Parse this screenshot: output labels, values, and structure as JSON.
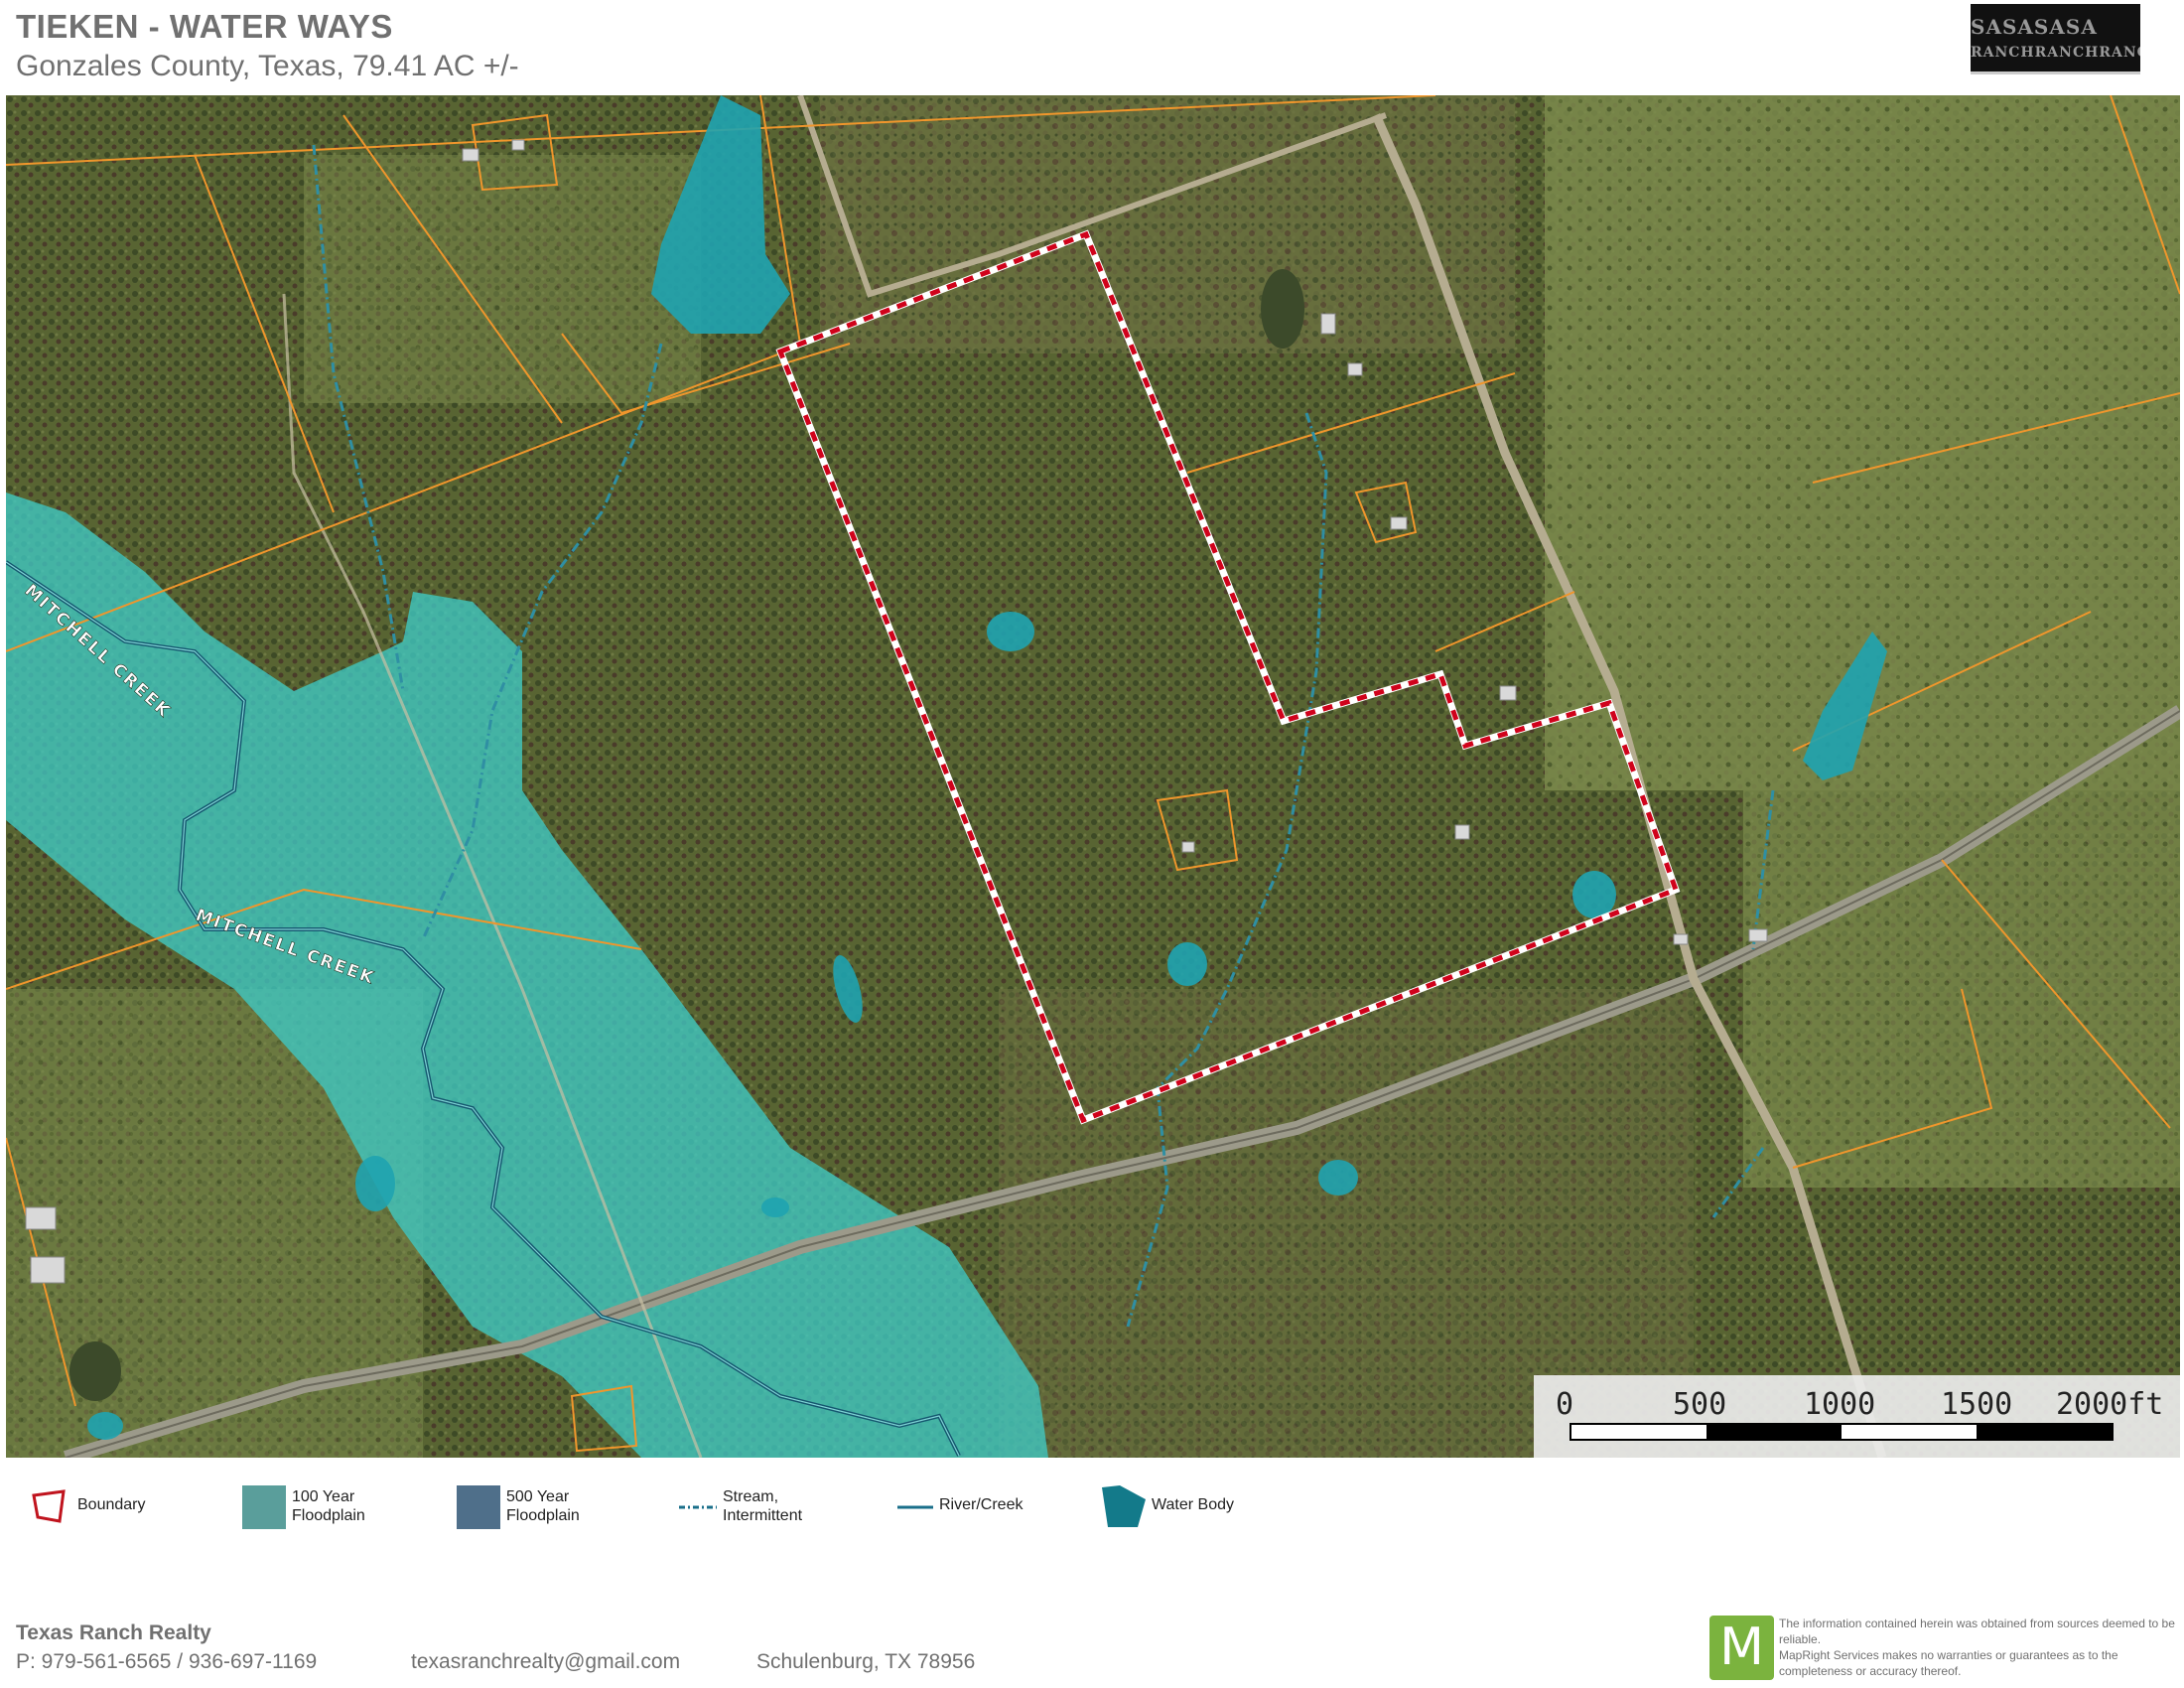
{
  "header": {
    "title": "TIEKEN - WATER WAYS",
    "subtitle": "Gonzales County, Texas, 79.41 AC +/-",
    "logo_text_1": "SASASASA",
    "logo_text_2": "RANCHRANCHRANCH"
  },
  "map": {
    "creek_label_1": "MITCHELL CREEK",
    "creek_label_2": "MITCHELL CREEK",
    "colors": {
      "boundary": "#d0021b",
      "floodplain_100": "#3fc9c4",
      "water_body": "#1fa3b0",
      "stream": "#2f8fa3",
      "parcel_lines": "#f0962c"
    }
  },
  "scale": {
    "ticks": [
      "0",
      "500",
      "1000",
      "1500",
      "2000ft"
    ]
  },
  "legend": {
    "boundary": "Boundary",
    "floodplain_100": "100 Year\nFloodplain",
    "floodplain_500": "500 Year\nFloodplain",
    "stream": "Stream,\nIntermittent",
    "river": "River/Creek",
    "water_body": "Water Body",
    "colors": {
      "boundary": "#c0141e",
      "floodplain_100": "#5a9e9b",
      "floodplain_500": "#4f6f8a",
      "stream": "#1a6f8a",
      "river": "#1a6f8a",
      "water_body": "#137a8a"
    }
  },
  "footer": {
    "company": "Texas Ranch Realty",
    "phone": "P: 979-561-6565  /  936-697-1169",
    "email": "texasranchrealty@gmail.com",
    "address": "Schulenburg, TX 78956",
    "mapright_letter": "M",
    "disclaimer": "The information contained herein was obtained from sources deemed to be reliable.\n MapRight Services makes no warranties or guarantees as to the completeness or accuracy thereof."
  }
}
